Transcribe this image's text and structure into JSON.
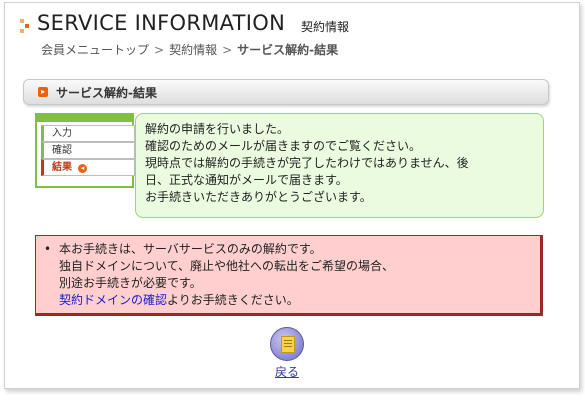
{
  "header": {
    "title": "SERVICE INFORMATION",
    "subtitle": "契約情報",
    "breadcrumb": {
      "home": "会員メニュートップ",
      "separator": ">",
      "contract": "契約情報",
      "current": "サービス解約-結果"
    }
  },
  "section": {
    "title": "サービス解約-結果",
    "icon": "arrow-right-icon"
  },
  "steps": [
    {
      "label": "入力",
      "active": false
    },
    {
      "label": "確認",
      "active": false
    },
    {
      "label": "結果",
      "active": true
    }
  ],
  "notice": {
    "lines": [
      "解約の申請を行いました。",
      "確認のためのメールが届きますのでご覧ください。",
      "現時点では解約の手続きが完了したわけではありません、後",
      "日、正式な通知がメールで届きます。",
      "お手続きいただきありがとうございます。"
    ]
  },
  "warning": {
    "bullet": "•",
    "lines": [
      "本お手続きは、サーバサービスのみの解約です。",
      "独自ドメインについて、廃止や他社への転出をご希望の場合、",
      "別途お手続きが必要です。"
    ],
    "link_text": "契約ドメインの確認",
    "link_suffix": "よりお手続きください。"
  },
  "back": {
    "label": "戻る",
    "icon": "document-icon"
  },
  "colors": {
    "accent_orange": "#e8630f",
    "step_green": "#7fbf43",
    "notice_bg": "#eafbe0",
    "warning_bg": "#ffcfcf",
    "link": "#1a1acf"
  }
}
